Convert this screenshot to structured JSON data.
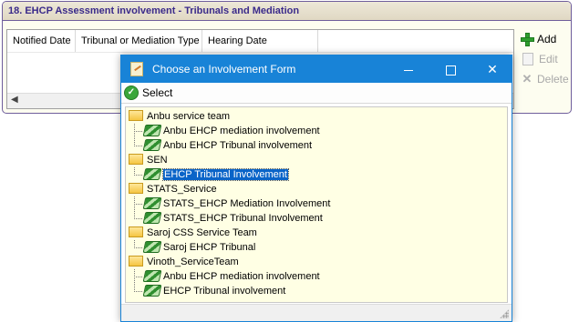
{
  "panel": {
    "title": "18. EHCP Assessment involvement - Tribunals and Mediation",
    "columns": [
      "Notified Date",
      "Tribunal or Mediation Type",
      "Hearing Date"
    ],
    "actions": {
      "add": "Add",
      "edit": "Edit",
      "delete": "Delete"
    }
  },
  "dialog": {
    "title": "Choose an Involvement Form",
    "toolbar": {
      "select": "Select"
    },
    "groups": [
      {
        "name": "Anbu service team",
        "items": [
          "Anbu EHCP mediation involvement",
          "Anbu EHCP Tribunal involvement"
        ]
      },
      {
        "name": "SEN",
        "items": [
          "EHCP Tribunal Involvement"
        ]
      },
      {
        "name": "STATS_Service",
        "items": [
          "STATS_EHCP Mediation Involvement",
          "STATS_EHCP Tribunal Involvement"
        ]
      },
      {
        "name": "Saroj CSS Service Team",
        "items": [
          "Saroj EHCP Tribunal"
        ]
      },
      {
        "name": "Vinoth_ServiceTeam",
        "items": [
          "Anbu EHCP mediation involvement",
          "EHCP Tribunal involvement"
        ]
      }
    ],
    "selected": "EHCP Tribunal Involvement"
  },
  "colors": {
    "titlebar": "#1883d7",
    "panel_border": "#6f5e9c",
    "selection": "#0a64c8",
    "tree_bg": "#ffffe4"
  }
}
